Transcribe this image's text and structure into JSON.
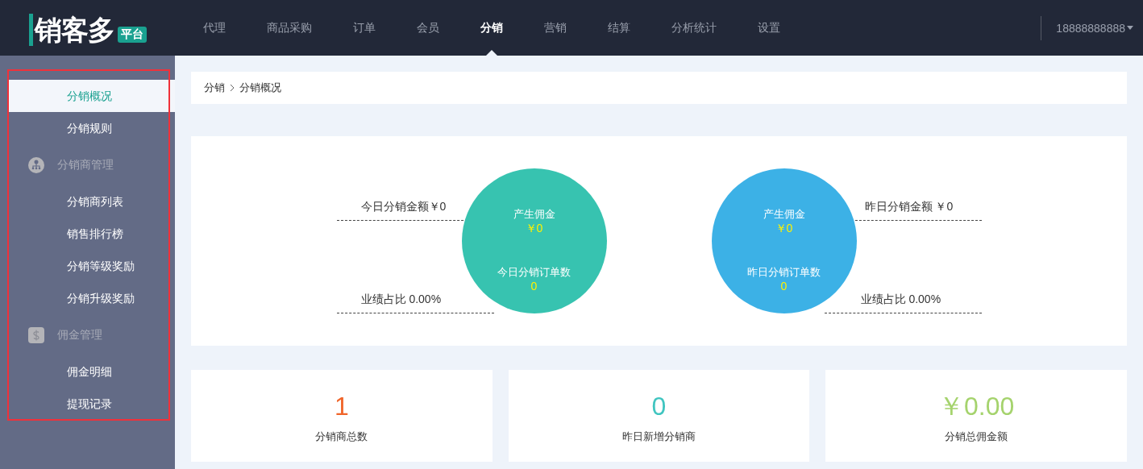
{
  "header": {
    "logo": {
      "text": "销客多",
      "badge": "平台"
    },
    "nav": [
      {
        "label": "代理",
        "selected": false
      },
      {
        "label": "商品采购",
        "selected": false
      },
      {
        "label": "订单",
        "selected": false
      },
      {
        "label": "会员",
        "selected": false
      },
      {
        "label": "分销",
        "selected": true
      },
      {
        "label": "营销",
        "selected": false
      },
      {
        "label": "结算",
        "selected": false
      },
      {
        "label": "分析统计",
        "selected": false
      },
      {
        "label": "设置",
        "selected": false
      }
    ],
    "user": "18888888888"
  },
  "sidebar": {
    "items": [
      {
        "kind": "link",
        "label": "分销概况",
        "selected": true
      },
      {
        "kind": "link",
        "label": "分销规则",
        "selected": false
      },
      {
        "kind": "group",
        "label": "分销商管理"
      },
      {
        "kind": "link",
        "label": "分销商列表",
        "selected": false
      },
      {
        "kind": "link",
        "label": "销售排行榜",
        "selected": false
      },
      {
        "kind": "link",
        "label": "分销等级奖励",
        "selected": false
      },
      {
        "kind": "link",
        "label": "分销升级奖励",
        "selected": false
      },
      {
        "kind": "group",
        "label": "佣金管理"
      },
      {
        "kind": "link",
        "label": "佣金明细",
        "selected": false
      },
      {
        "kind": "link",
        "label": "提现记录",
        "selected": false
      }
    ]
  },
  "breadcrumb": [
    "分销",
    "分销概况"
  ],
  "overview": [
    {
      "kind": "left",
      "color": "#37c3b0",
      "amount": "今日分销金额￥0",
      "ratio": "业绩占比 0.00%",
      "commission_label": "产生佣金",
      "commission_value": "￥0",
      "orders_label": "今日分销订单数",
      "orders_value": "0"
    },
    {
      "kind": "right",
      "color": "#3cb1e6",
      "amount": "昨日分销金额 ￥0",
      "ratio": "业绩占比 0.00%",
      "commission_label": "产生佣金",
      "commission_value": "￥0",
      "orders_label": "昨日分销订单数",
      "orders_value": "0"
    }
  ],
  "totals": [
    {
      "value": "1",
      "label": "分销商总数",
      "color": "#f0652a"
    },
    {
      "value": "0",
      "label": "昨日新增分销商",
      "color": "#40c5c0"
    },
    {
      "value": "￥0.00",
      "label": "分销总佣金额",
      "color": "#a5d36d"
    }
  ]
}
